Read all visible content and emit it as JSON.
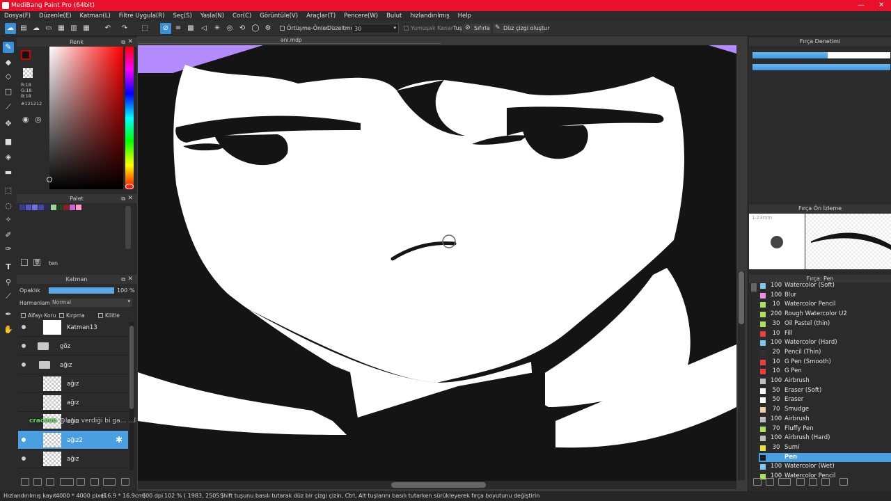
{
  "window": {
    "title": "MediBang Paint Pro (64bit)"
  },
  "menu": [
    "Dosya(F)",
    "Düzenle(E)",
    "Katman(L)",
    "Filtre Uygula(R)",
    "Seç(S)",
    "Yasla(N)",
    "Cor(C)",
    "Görüntüle(V)",
    "Araçlar(T)",
    "Pencere(W)",
    "Bulut",
    "hızlandırılmış",
    "Help"
  ],
  "toolbar": {
    "overlap_label": "Örtüşme-Önler",
    "correction_label": "Düzeltme",
    "correction_value": "30",
    "soft_edge_label": "Yumuşak Kenar",
    "tus_label": "Tuş",
    "reset_label": "Sıfırla",
    "line_label": "Düz çizgi oluştur"
  },
  "canvas": {
    "filename": "ani.mdp"
  },
  "color_panel": {
    "title": "Renk",
    "r": "R:18",
    "g": "G:18",
    "b": "B:18",
    "hex": "#121212",
    "primary": "#121212",
    "secondary": "#ffffff"
  },
  "palette_panel": {
    "title": "Palet",
    "swatches": [
      "#3a3a8a",
      "#5555cc",
      "#7070e0",
      "#4444aa",
      "#2a2a55",
      "#99d699",
      "#224422",
      "#8a2020",
      "#cc66cc",
      "#ff99cc"
    ],
    "item_label": "ten"
  },
  "layer_panel": {
    "title": "Katman",
    "opacity_label": "Opaklık",
    "opacity_value": "100 %",
    "opacity_fraction": 1.0,
    "blend_label": "Harmanlama",
    "blend_value": "Normal",
    "alpha_protect": "Alfayı Koru",
    "clipping": "Kırpma",
    "lock": "Kilitle",
    "layers": [
      {
        "name": "Katman13"
      },
      {
        "name": "göz"
      },
      {
        "name": "ağız"
      },
      {
        "name": "ağız"
      },
      {
        "name": "ağız"
      },
      {
        "name": "ağız"
      },
      {
        "name": "ağız2"
      },
      {
        "name": "ağız"
      }
    ]
  },
  "chat_overlay": {
    "user": "cracmm",
    "message": "@lerin verdiği bi ga... ...la ve dergisi"
  },
  "brush_control": {
    "title": "Fırça Denetimi"
  },
  "brush_preview": {
    "title": "Fırça Ön İzleme",
    "size_label": "1.23mm"
  },
  "brush_list": {
    "title": "Fırça: Pen",
    "items": [
      {
        "size": "100",
        "name": "Watercolor (Soft)",
        "color": "#7ec8f0"
      },
      {
        "size": "100",
        "name": "Blur",
        "color": "#f08ee0"
      },
      {
        "size": "10",
        "name": "Watercolor Pencil",
        "color": "#a8e060"
      },
      {
        "size": "200",
        "name": "Rough Watercolor U2",
        "color": "#a8e060"
      },
      {
        "size": "30",
        "name": "Oil Pastel (thin)",
        "color": "#a8e060"
      },
      {
        "size": "10",
        "name": "Fill",
        "color": "#e84040"
      },
      {
        "size": "100",
        "name": "Watercolor (Hard)",
        "color": "#7ec8f0"
      },
      {
        "size": "20",
        "name": "Pencil (Thin)",
        "color": "#303030"
      },
      {
        "size": "10",
        "name": "G Pen (Smooth)",
        "color": "#e84040"
      },
      {
        "size": "10",
        "name": "G Pen",
        "color": "#e84040"
      },
      {
        "size": "100",
        "name": "Airbrush",
        "color": "#c0c0c0"
      },
      {
        "size": "50",
        "name": "Eraser (Soft)",
        "color": "#ffffff"
      },
      {
        "size": "50",
        "name": "Eraser",
        "color": "#ffffff"
      },
      {
        "size": "70",
        "name": "Smudge",
        "color": "#f0d0a0"
      },
      {
        "size": "100",
        "name": "Airbrush",
        "color": "#c0c0c0"
      },
      {
        "size": "70",
        "name": "Fluffy Pen",
        "color": "#a8e060"
      },
      {
        "size": "100",
        "name": "Airbrush (Hard)",
        "color": "#c0c0c0"
      },
      {
        "size": "30",
        "name": "Sumi",
        "color": "#e8e040"
      },
      {
        "size": "",
        "name": "Pen",
        "color": "#1a1a1a"
      },
      {
        "size": "100",
        "name": "Watercolor (Wet)",
        "color": "#7ec8f0"
      },
      {
        "size": "100",
        "name": "Watercolor Pencil",
        "color": "#a8e060"
      }
    ]
  },
  "statusbar": {
    "label": "Hızlandırılmış kayıt",
    "size": "4000 * 4000 pixel",
    "cm": "(16.9 * 16.9cm)",
    "dpi": "600 dpi",
    "zoom": "102 %",
    "coords": "( 1983, 2505 )",
    "hint": "Shift tuşunu basılı tutarak düz bir çizgi çizin, Ctrl, Alt tuşlarını basılı tutarken sürükleyerek fırça boyutunu değiştirin"
  }
}
